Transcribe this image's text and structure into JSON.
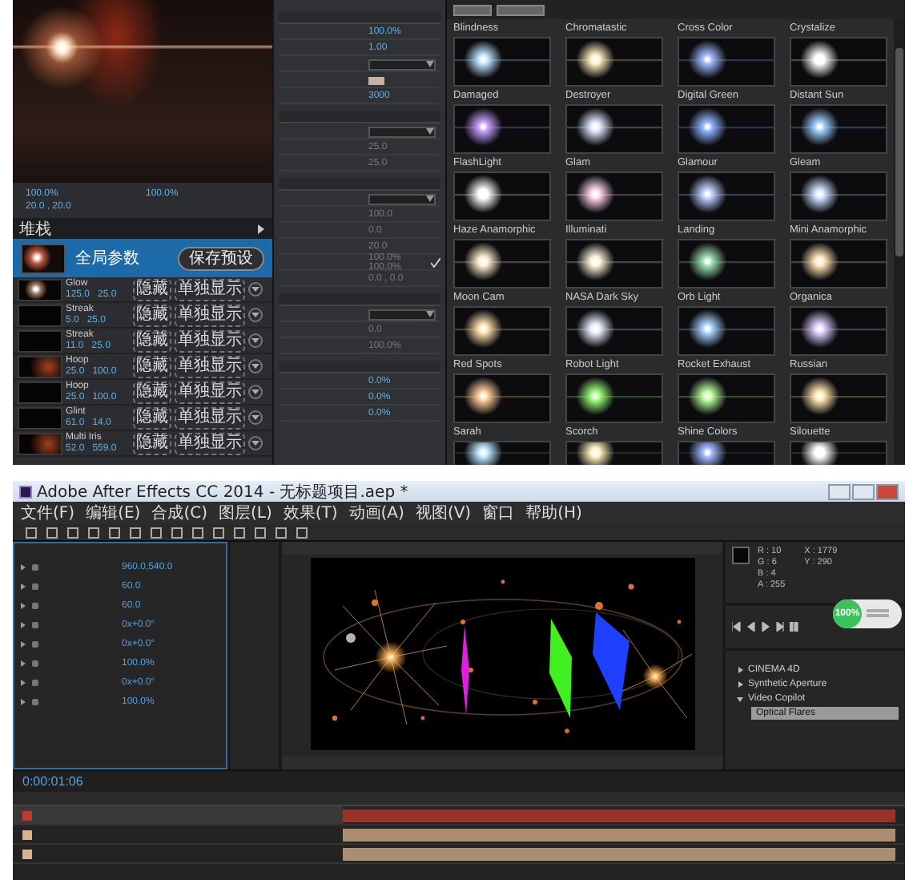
{
  "lens_editor": {
    "preview_stats": [
      "100.0%",
      "100.0%",
      "20.0 , 20.0"
    ],
    "stack": {
      "title": "堆栈",
      "global": {
        "title": "全局参数",
        "save_button": "保存预设"
      },
      "elements": [
        {
          "name": "Glow",
          "value_1": "125.0",
          "value_2": "25.0",
          "hide": "隐藏",
          "solo": "单独显示"
        },
        {
          "name": "Streak",
          "value_1": "5.0",
          "value_2": "25.0",
          "hide": "隐藏",
          "solo": "单独显示"
        },
        {
          "name": "Streak",
          "value_1": "11.0",
          "value_2": "25.0",
          "hide": "隐藏",
          "solo": "单独显示"
        },
        {
          "name": "Hoop",
          "value_1": "25.0",
          "value_2": "100.0",
          "hide": "隐藏",
          "solo": "单独显示"
        },
        {
          "name": "Hoop",
          "value_1": "25.0",
          "value_2": "100.0",
          "hide": "隐藏",
          "solo": "单独显示"
        },
        {
          "name": "Glint",
          "value_1": "61.0",
          "value_2": "14.0",
          "hide": "隐藏",
          "solo": "单独显示"
        },
        {
          "name": "Multi Iris",
          "value_1": "52.0",
          "value_2": "559.0",
          "hide": "隐藏",
          "solo": "单独显示"
        }
      ]
    },
    "properties": {
      "sections": [
        {
          "rows": [
            {
              "kind": "text",
              "value": "100.0%",
              "disabled": false
            },
            {
              "kind": "text",
              "value": "1.00",
              "disabled": false
            },
            {
              "kind": "dropdown",
              "disabled": false
            },
            {
              "kind": "swatch",
              "disabled": false
            },
            {
              "kind": "text",
              "value": "3000",
              "disabled": false
            }
          ]
        },
        {
          "rows": [
            {
              "kind": "dropdown",
              "disabled": false
            },
            {
              "kind": "text",
              "value": "25.0",
              "disabled": true
            },
            {
              "kind": "text",
              "value": "25.0",
              "disabled": true
            }
          ]
        },
        {
          "rows": [
            {
              "kind": "dropdown",
              "disabled": false
            },
            {
              "kind": "text",
              "value": "100.0",
              "disabled": true
            },
            {
              "kind": "text",
              "value": "0.0",
              "disabled": true
            },
            {
              "kind": "text",
              "value": "20.0",
              "disabled": true
            },
            {
              "kind": "check",
              "value": "100.0%  100.0%",
              "disabled": true
            },
            {
              "kind": "text",
              "value": "0.0 , 0.0",
              "disabled": true
            }
          ]
        },
        {
          "rows": [
            {
              "kind": "dropdown",
              "disabled": false
            },
            {
              "kind": "text",
              "value": "0.0",
              "disabled": true
            },
            {
              "kind": "text",
              "value": "100.0%",
              "disabled": true
            }
          ]
        },
        {
          "rows": [
            {
              "kind": "text",
              "value": "0.0%",
              "disabled": false
            },
            {
              "kind": "text",
              "value": "0.0%",
              "disabled": false
            },
            {
              "kind": "text",
              "value": "0.0%",
              "disabled": false
            }
          ]
        }
      ]
    }
  },
  "preset_browser": {
    "presets": [
      {
        "kind": "label_only",
        "name": "Blindness"
      },
      {
        "kind": "label_only",
        "name": "Chromatastic"
      },
      {
        "kind": "label_only",
        "name": "Cross Color"
      },
      {
        "kind": "label_only",
        "name": "Crystalize"
      },
      {
        "kind": "full",
        "name": "Damaged"
      },
      {
        "kind": "full",
        "name": "Destroyer"
      },
      {
        "kind": "full",
        "name": "Digital Green"
      },
      {
        "kind": "full",
        "name": "Distant Sun"
      },
      {
        "kind": "full",
        "name": "FlashLight"
      },
      {
        "kind": "full",
        "name": "Glam"
      },
      {
        "kind": "full",
        "name": "Glamour"
      },
      {
        "kind": "full",
        "name": "Gleam"
      },
      {
        "kind": "full",
        "name": "Haze Anamorphic"
      },
      {
        "kind": "full",
        "name": "Illuminati"
      },
      {
        "kind": "full",
        "name": "Landing"
      },
      {
        "kind": "full",
        "name": "Mini Anamorphic"
      },
      {
        "kind": "full",
        "name": "Moon Cam"
      },
      {
        "kind": "full",
        "name": "NASA Dark Sky"
      },
      {
        "kind": "full",
        "name": "Orb Light"
      },
      {
        "kind": "full",
        "name": "Organica"
      },
      {
        "kind": "full",
        "name": "Red Spots"
      },
      {
        "kind": "full",
        "name": "Robot Light"
      },
      {
        "kind": "full",
        "name": "Rocket Exhaust"
      },
      {
        "kind": "full",
        "name": "Russian"
      },
      {
        "kind": "full",
        "name": "Sarah"
      },
      {
        "kind": "full",
        "name": "Scorch"
      },
      {
        "kind": "full",
        "name": "Shine Colors"
      },
      {
        "kind": "full",
        "name": "Silouette"
      },
      {
        "kind": "thumb_only"
      },
      {
        "kind": "thumb_only"
      },
      {
        "kind": "thumb_only"
      },
      {
        "kind": "thumb_only"
      }
    ]
  },
  "after_effects": {
    "window": {
      "title": "Adobe After Effects CC 2014 - 无标题项目.aep *"
    },
    "menu": [
      "文件(F)",
      "编辑(E)",
      "合成(C)",
      "图层(L)",
      "效果(T)",
      "动画(A)",
      "视图(V)",
      "窗口",
      "帮助(H)"
    ],
    "effect_controls": {
      "rows": [
        "960.0,540.0",
        "60.0",
        "60.0",
        "0x+0.0°",
        "0x+0.0°",
        "100.0%",
        "0x+0.0°",
        "100.0%"
      ]
    },
    "info": {
      "lines": [
        "R : 10",
        "G : 6",
        "B : 4",
        "A : 255",
        "X : 1779",
        "Y : 290"
      ]
    },
    "monitor_badge": {
      "value": "100%"
    },
    "effects_presets": {
      "items": [
        {
          "label": "CINEMA 4D",
          "expanded": false,
          "selected": false
        },
        {
          "label": "Synthetic Aperture",
          "expanded": false,
          "selected": false
        },
        {
          "label": "Video Copilot",
          "expanded": true,
          "selected": false,
          "children": [
            {
              "label": "Optical Flares",
              "selected": true
            }
          ]
        }
      ]
    },
    "timeline": {
      "timecode": "0:00:01:06",
      "layers": [
        {
          "color": "#c0392b",
          "selected": true
        },
        {
          "color": "#d9b38c",
          "selected": false
        },
        {
          "color": "#d9b38c",
          "selected": false
        }
      ]
    }
  }
}
